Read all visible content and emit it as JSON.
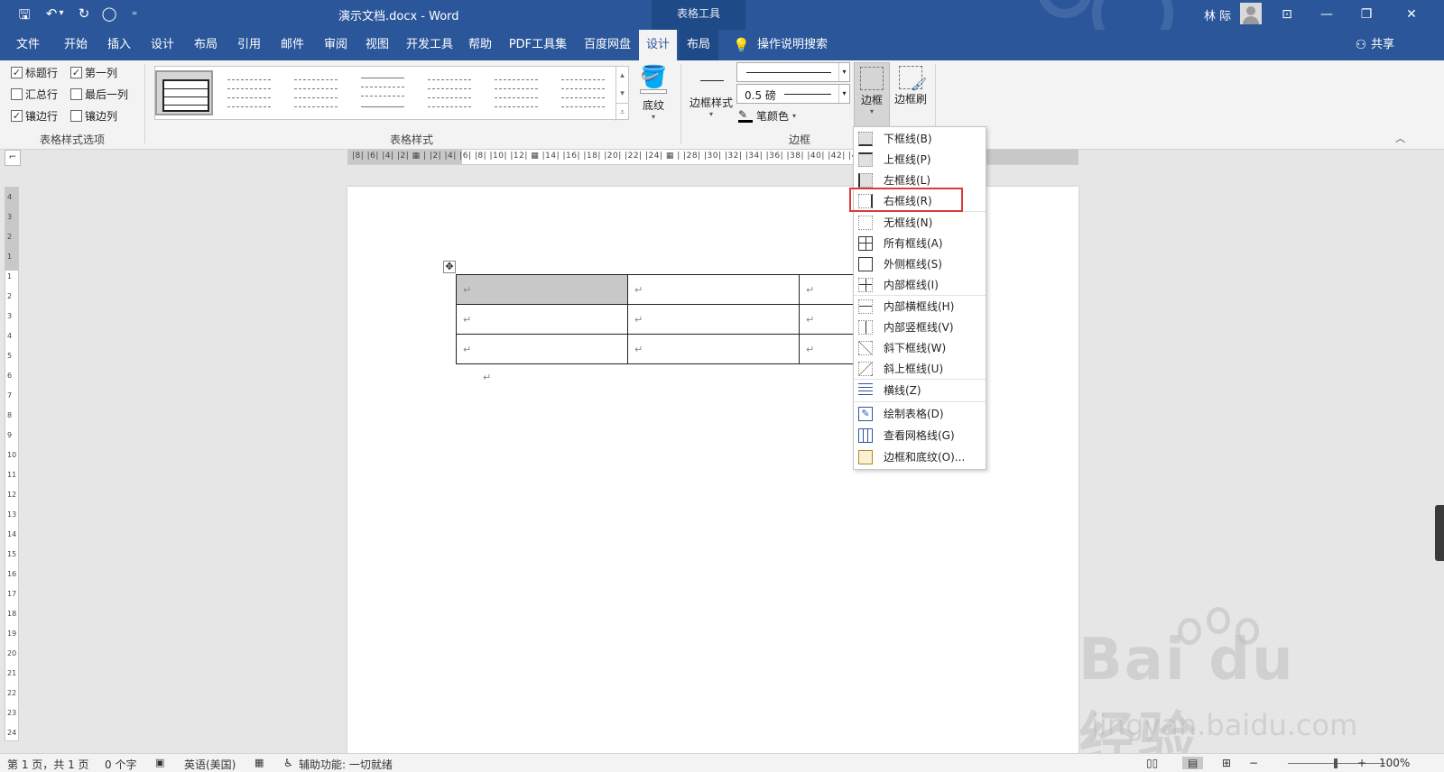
{
  "titlebar": {
    "doc_title": "演示文档.docx  -  Word",
    "context_tab_header": "表格工具",
    "user_name": "林 际",
    "qa_save": "🖫",
    "qa_undo": "↶",
    "qa_undo_dropdown": "▾",
    "qa_redo": "↻",
    "qa_touch": "◯",
    "qa_customize": "₌",
    "win_display_options": "⊡",
    "win_minimize": "—",
    "win_restore": "❐",
    "win_close": "✕"
  },
  "tabs": [
    {
      "label": "文件"
    },
    {
      "label": "开始"
    },
    {
      "label": "插入"
    },
    {
      "label": "设计"
    },
    {
      "label": "布局"
    },
    {
      "label": "引用"
    },
    {
      "label": "邮件"
    },
    {
      "label": "审阅"
    },
    {
      "label": "视图"
    },
    {
      "label": "开发工具"
    },
    {
      "label": "帮助"
    },
    {
      "label": "PDF工具集"
    },
    {
      "label": "百度网盘"
    },
    {
      "label": "设计"
    },
    {
      "label": "布局"
    }
  ],
  "tell_me": "操作说明搜索",
  "share": "共享",
  "ribbon": {
    "style_options": {
      "label": "表格样式选项",
      "items": [
        {
          "label": "标题行",
          "checked": true
        },
        {
          "label": "第一列",
          "checked": true
        },
        {
          "label": "汇总行",
          "checked": false
        },
        {
          "label": "最后一列",
          "checked": false
        },
        {
          "label": "镶边行",
          "checked": true
        },
        {
          "label": "镶边列",
          "checked": false
        }
      ],
      "check_glyph": "✓"
    },
    "table_styles": {
      "label": "表格样式"
    },
    "shading": {
      "label": "底纹"
    },
    "borders": {
      "label": "边框",
      "border_styles_label": "边框样式",
      "weight_value": "0.5 磅",
      "pen_color_label": "笔颜色",
      "border_button_label": "边框",
      "border_painter_label": "边框刷",
      "pen_color_hex": "#000000"
    },
    "collapse_glyph": "︿"
  },
  "ruler": {
    "horizontal_text": "|8|  |6|  |4|  |2|  ▦  |  |2|  |4|  |6|  |8|  |10|  |12| ▦ |14|  |16|  |18|  |20|  |22|  |24| ▦ |  |28|  |30|  |32|  |34|  |36|  |38|  |40|  |42|  |44|  |46|",
    "vertical_text": [
      "4",
      "3",
      "2",
      "1",
      "1",
      "2",
      "3",
      "4",
      "5",
      "6",
      "7",
      "8",
      "9",
      "10",
      "11",
      "12",
      "13",
      "14",
      "15",
      "16",
      "17",
      "18",
      "19",
      "20",
      "21",
      "22",
      "23",
      "24"
    ],
    "corner_glyph": "⌐"
  },
  "document": {
    "move_handle": "✥",
    "paragraph_mark": "↵",
    "rows": [
      [
        "↵",
        "↵",
        "↵"
      ],
      [
        "↵",
        "↵",
        "↵"
      ],
      [
        "↵",
        "↵",
        "↵"
      ]
    ]
  },
  "border_menu": {
    "items": [
      {
        "label": "下框线(B)"
      },
      {
        "label": "上框线(P)"
      },
      {
        "label": "左框线(L)"
      },
      {
        "label": "右框线(R)",
        "highlighted": true
      },
      {
        "label": "无框线(N)"
      },
      {
        "label": "所有框线(A)"
      },
      {
        "label": "外侧框线(S)"
      },
      {
        "label": "内部框线(I)"
      },
      {
        "label": "内部横框线(H)"
      },
      {
        "label": "内部竖框线(V)"
      },
      {
        "label": "斜下框线(W)"
      },
      {
        "label": "斜上框线(U)"
      },
      {
        "label": "横线(Z)"
      },
      {
        "label": "绘制表格(D)"
      },
      {
        "label": "查看网格线(G)"
      },
      {
        "label": "边框和底纹(O)..."
      }
    ],
    "highlight_color": "#d93a3a"
  },
  "statusbar": {
    "page": "第 1 页，共 1 页",
    "words": "0 个字",
    "language": "英语(美国)",
    "accessibility": "辅助功能: 一切就绪",
    "zoom": "100%",
    "zoom_minus": "−",
    "zoom_plus": "+"
  },
  "watermark": {
    "main": "Bai du 经验",
    "sub": "jingyan.baidu.com"
  },
  "colors": {
    "word_blue": "#2b579a",
    "context_blue": "#1e4a87",
    "ribbon_bg": "#f3f3f3"
  }
}
